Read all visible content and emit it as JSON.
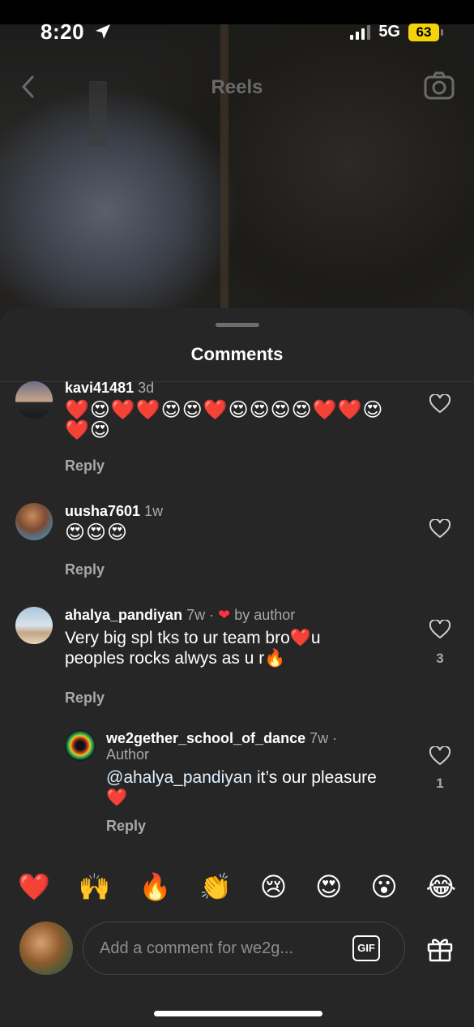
{
  "status_bar": {
    "time": "8:20",
    "network": "5G",
    "battery": "63",
    "icons": [
      "location-arrow-icon",
      "signal-icon",
      "battery-icon"
    ],
    "battery_color": "#f5d30a"
  },
  "reels_header": {
    "title": "Reels",
    "icons": [
      "back-chevron-icon",
      "camera-icon"
    ]
  },
  "sheet": {
    "title": "Comments"
  },
  "comments": [
    {
      "username": "kavi41481",
      "time": "3d",
      "text_line1": "❤️😍❤️❤️😍😍❤️😍😍😍😍❤️❤️😍",
      "text_line2": "❤️😍",
      "reply": "Reply"
    },
    {
      "username": "uusha7601",
      "time": "1w",
      "text_line1": "😍😍😍",
      "reply": "Reply"
    },
    {
      "username": "ahalya_pandiyan",
      "time": "7w",
      "separator": "·",
      "badge": "by author",
      "text_line1": "Very big spl tks to ur team bro❤️u",
      "text_line2": "peoples rocks alwys as u r🔥",
      "reply": "Reply",
      "likes": "3"
    },
    {
      "username": "we2gether_school_of_dance",
      "time": "7w ·",
      "role": "Author",
      "mention": "@ahalya_pandiyan",
      "text_line1": " it’s our pleasure",
      "text_line2": "❤️",
      "reply": "Reply",
      "likes": "1"
    }
  ],
  "reactions": [
    "❤️",
    "🙌",
    "🔥",
    "👏",
    "😢",
    "😍",
    "😮",
    "😂"
  ],
  "composer": {
    "placeholder": "Add a comment for we2g...",
    "gif_label": "GIF",
    "icons": [
      "gif-icon",
      "gift-icon"
    ]
  },
  "colors": {
    "sheet_bg": "#262626",
    "muted_text": "#a8a8a8",
    "like_red": "#ff3040"
  }
}
